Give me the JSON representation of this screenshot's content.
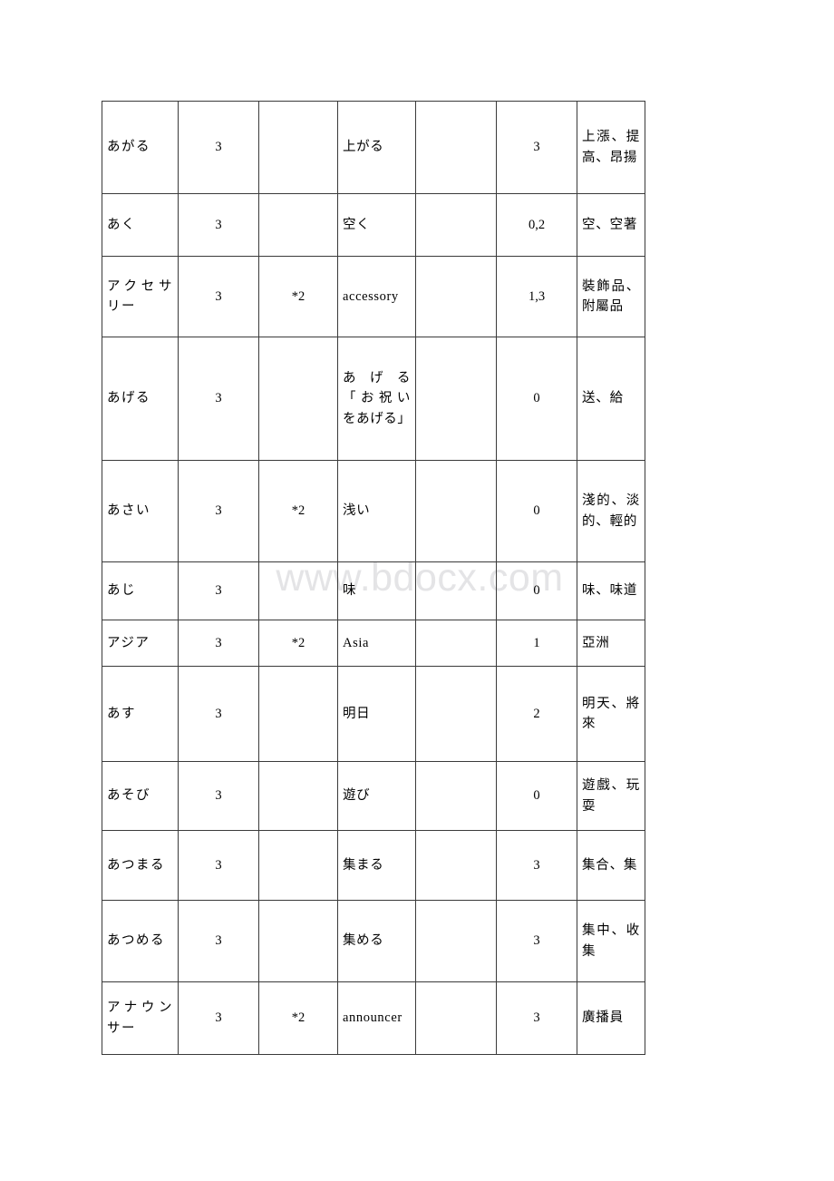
{
  "watermark": {
    "text": "www.bdocx.com",
    "color": "#e4e4e6"
  },
  "table": {
    "column_count": 7,
    "row_count": 12,
    "columns": [
      {
        "key": "reading",
        "role": "kana-reading"
      },
      {
        "key": "level",
        "role": "level-number"
      },
      {
        "key": "note",
        "role": "note-marker"
      },
      {
        "key": "writing",
        "role": "written-form"
      },
      {
        "key": "blank",
        "role": "empty-column"
      },
      {
        "key": "accent",
        "role": "pitch-accent"
      },
      {
        "key": "meaning",
        "role": "chinese-meaning"
      }
    ],
    "rows": [
      {
        "reading": "あがる",
        "level": "3",
        "note": "",
        "writing": "上がる",
        "blank": "",
        "accent": "3",
        "meaning": "上漲、提高、昂揚"
      },
      {
        "reading": "あく",
        "level": "3",
        "note": "",
        "writing": "空く",
        "blank": "",
        "accent": "0,2",
        "meaning": "空、空著"
      },
      {
        "reading": "アクセサリー",
        "level": "3",
        "note": "*2",
        "writing": "accessory",
        "blank": "",
        "accent": "1,3",
        "meaning": "裝飾品、附屬品"
      },
      {
        "reading": "あげる",
        "level": "3",
        "note": "",
        "writing": "あげる「お祝いをあげる」",
        "blank": "",
        "accent": "0",
        "meaning": "送、給"
      },
      {
        "reading": "あさい",
        "level": "3",
        "note": "*2",
        "writing": "浅い",
        "blank": "",
        "accent": "0",
        "meaning": "淺的、淡的、輕的"
      },
      {
        "reading": "あじ",
        "level": "3",
        "note": "",
        "writing": "味",
        "blank": "",
        "accent": "0",
        "meaning": "味、味道"
      },
      {
        "reading": "アジア",
        "level": "3",
        "note": "*2",
        "writing": "Asia",
        "blank": "",
        "accent": "1",
        "meaning": "亞洲"
      },
      {
        "reading": "あす",
        "level": "3",
        "note": "",
        "writing": "明日",
        "blank": "",
        "accent": "2",
        "meaning": "明天、將來"
      },
      {
        "reading": "あそび",
        "level": "3",
        "note": "",
        "writing": "遊び",
        "blank": "",
        "accent": "0",
        "meaning": "遊戲、玩耍"
      },
      {
        "reading": "あつまる",
        "level": "3",
        "note": "",
        "writing": "集まる",
        "blank": "",
        "accent": "3",
        "meaning": "集合、集"
      },
      {
        "reading": "あつめる",
        "level": "3",
        "note": "",
        "writing": "集める",
        "blank": "",
        "accent": "3",
        "meaning": "集中、收集"
      },
      {
        "reading": "アナウンサー",
        "level": "3",
        "note": "*2",
        "writing": "announcer",
        "blank": "",
        "accent": "3",
        "meaning": "廣播員"
      }
    ]
  }
}
